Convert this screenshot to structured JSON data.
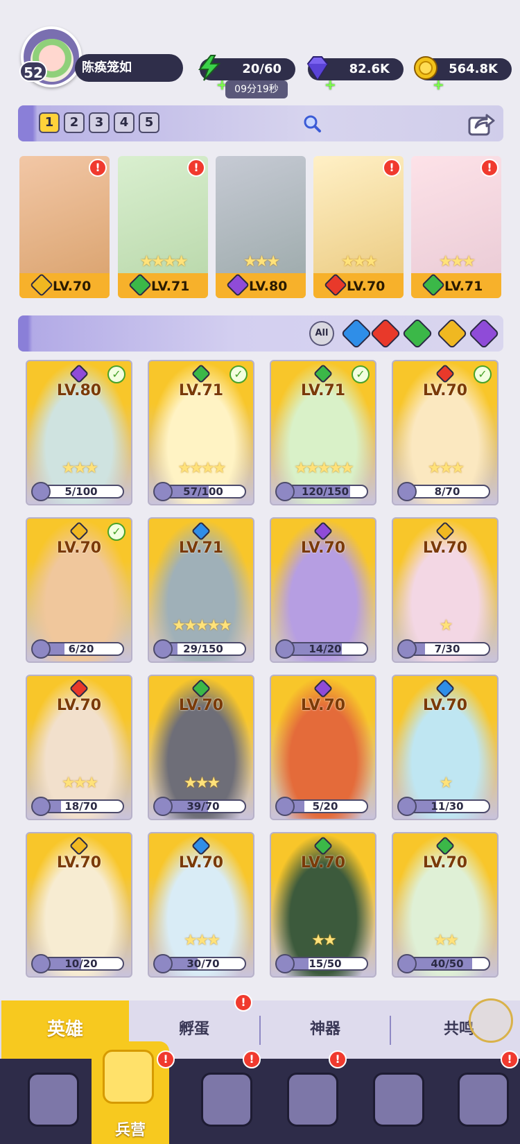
{
  "player": {
    "level": "52",
    "name": "陈痪笼如"
  },
  "resources": {
    "energy": {
      "value": "20/60",
      "timer": "09分19秒",
      "icon": "lightning-icon",
      "color": "#3bd24a"
    },
    "gems": {
      "value": "82.6K",
      "icon": "gem-icon",
      "color": "#7b63f0"
    },
    "coins": {
      "value": "564.8K",
      "icon": "coin-icon",
      "color": "#f2c21a"
    }
  },
  "team_tabs": [
    "1",
    "2",
    "3",
    "4",
    "5"
  ],
  "team_tab_active": 0,
  "team_slots": [
    {
      "level": "LV.70",
      "element": "light",
      "stars": "",
      "alert": "!"
    },
    {
      "level": "LV.71",
      "element": "nature",
      "stars": "★★★★",
      "alert": "!"
    },
    {
      "level": "LV.80",
      "element": "dark",
      "stars": "★★★",
      "alert": ""
    },
    {
      "level": "LV.70",
      "element": "fire",
      "stars": "★★★",
      "alert": "!"
    },
    {
      "level": "LV.71",
      "element": "nature",
      "stars": "★★★",
      "alert": "!"
    }
  ],
  "filters": {
    "all_label": "All",
    "elements": [
      "water",
      "fire",
      "nature",
      "light",
      "dark"
    ]
  },
  "element_colors": {
    "light": "#f0b821",
    "nature": "#3bb848",
    "dark": "#8f4bd8",
    "fire": "#e8392a",
    "water": "#2f8ee8"
  },
  "heroes": [
    {
      "level": "LV.80",
      "element": "dark",
      "stars": "★★★",
      "progress": "5/100",
      "ratio": 0.05,
      "checked": true
    },
    {
      "level": "LV.71",
      "element": "nature",
      "stars": "★★★★",
      "progress": "57/100",
      "ratio": 0.57,
      "checked": true
    },
    {
      "level": "LV.71",
      "element": "nature",
      "stars": "★★★★★",
      "progress": "120/150",
      "ratio": 0.8,
      "checked": true
    },
    {
      "level": "LV.70",
      "element": "fire",
      "stars": "★★★",
      "progress": "8/70",
      "ratio": 0.11,
      "checked": true
    },
    {
      "level": "LV.70",
      "element": "light",
      "stars": "",
      "progress": "6/20",
      "ratio": 0.3,
      "checked": true
    },
    {
      "level": "LV.71",
      "element": "water",
      "stars": "★★★★★",
      "progress": "29/150",
      "ratio": 0.19,
      "checked": false
    },
    {
      "level": "LV.70",
      "element": "dark",
      "stars": "",
      "progress": "14/20",
      "ratio": 0.7,
      "checked": false
    },
    {
      "level": "LV.70",
      "element": "light",
      "stars": "★",
      "progress": "7/30",
      "ratio": 0.23,
      "checked": false
    },
    {
      "level": "LV.70",
      "element": "fire",
      "stars": "★★★",
      "progress": "18/70",
      "ratio": 0.26,
      "checked": false
    },
    {
      "level": "LV.70",
      "element": "nature",
      "stars": "★★★",
      "progress": "39/70",
      "ratio": 0.56,
      "checked": false
    },
    {
      "level": "LV.70",
      "element": "dark",
      "stars": "",
      "progress": "5/20",
      "ratio": 0.25,
      "checked": false
    },
    {
      "level": "LV.70",
      "element": "water",
      "stars": "★",
      "progress": "11/30",
      "ratio": 0.37,
      "checked": false
    },
    {
      "level": "LV.70",
      "element": "light",
      "stars": "",
      "progress": "10/20",
      "ratio": 0.5,
      "checked": false
    },
    {
      "level": "LV.70",
      "element": "water",
      "stars": "★★★",
      "progress": "30/70",
      "ratio": 0.43,
      "checked": false
    },
    {
      "level": "LV.70",
      "element": "nature",
      "stars": "★★",
      "progress": "15/50",
      "ratio": 0.3,
      "checked": false
    },
    {
      "level": "LV.70",
      "element": "nature",
      "stars": "★★",
      "progress": "40/50",
      "ratio": 0.8,
      "checked": false
    }
  ],
  "subnav": [
    {
      "label": "英雄",
      "active": true,
      "alert": ""
    },
    {
      "label": "孵蛋",
      "active": false,
      "alert": "!"
    },
    {
      "label": "神器",
      "active": false,
      "alert": ""
    },
    {
      "label": "共鸣",
      "active": false,
      "alert": ""
    }
  ],
  "bottomnav": [
    {
      "label": "",
      "icon": "cards-icon",
      "active": false,
      "alert": ""
    },
    {
      "label": "兵营",
      "icon": "barracks-icon",
      "active": true,
      "alert": "!"
    },
    {
      "label": "",
      "icon": "map-icon",
      "active": false,
      "alert": "!"
    },
    {
      "label": "",
      "icon": "castle-icon",
      "active": false,
      "alert": "!"
    },
    {
      "label": "",
      "icon": "mushroom-icon",
      "active": false,
      "alert": ""
    },
    {
      "label": "",
      "icon": "guild-icon",
      "active": false,
      "alert": "!"
    }
  ]
}
